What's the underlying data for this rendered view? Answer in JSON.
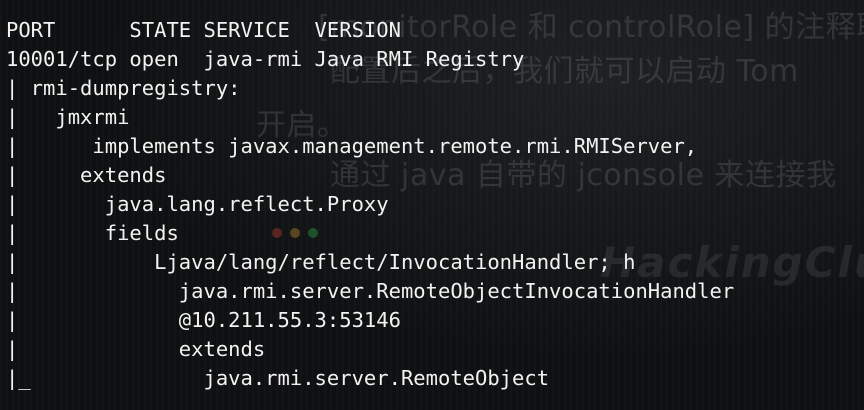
{
  "background": {
    "watermark_lines": [
      "[monitorRole 和 controlRole] 的注释取",
      "配置后之后，我们就可以启动 Tom",
      "开启。",
      "通过 java 自带的 jconsole 来连接我",
      "HackingClub"
    ],
    "dot_colors": [
      "#e0443a",
      "#e0a03a",
      "#3ac05a"
    ]
  },
  "terminal": {
    "text_color": "#f2f2f2",
    "background_color": "#0e1011",
    "lines": [
      "PORT      STATE SERVICE  VERSION",
      "10001/tcp open  java-rmi Java RMI Registry",
      "| rmi-dumpregistry:",
      "|   jmxrmi",
      "|      implements javax.management.remote.rmi.RMIServer,",
      "|     extends",
      "|       java.lang.reflect.Proxy",
      "|       fields",
      "|           Ljava/lang/reflect/InvocationHandler; h",
      "|             java.rmi.server.RemoteObjectInvocationHandler",
      "|             @10.211.55.3:53146",
      "|             extends",
      "|_              java.rmi.server.RemoteObject"
    ]
  }
}
